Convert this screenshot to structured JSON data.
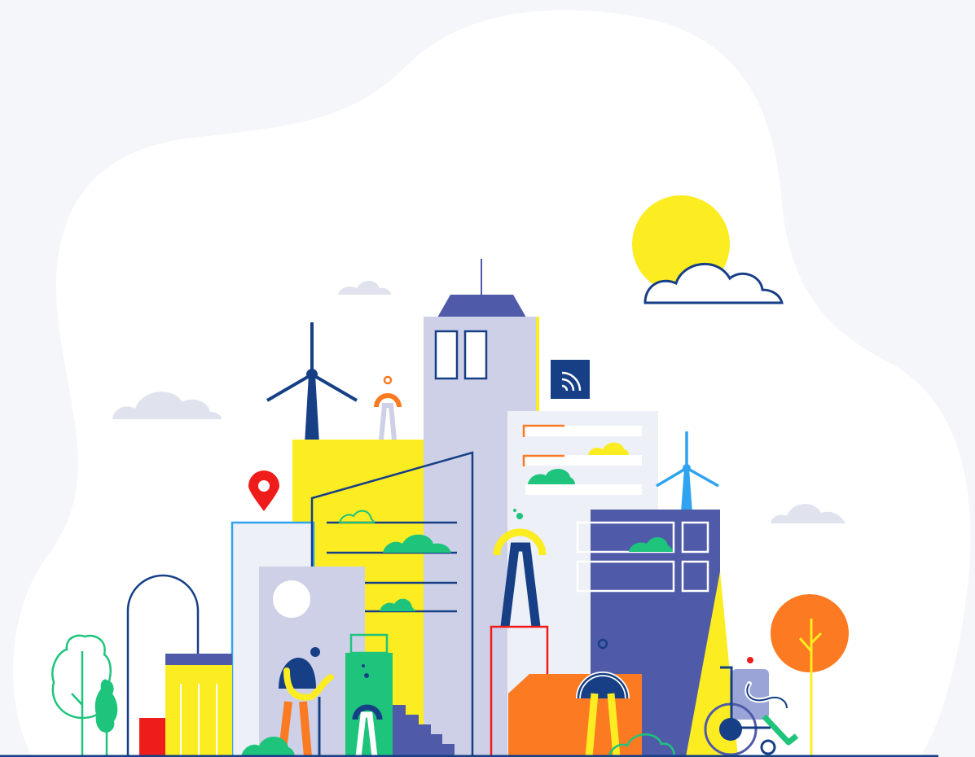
{
  "illustration": {
    "subject": "smart-city",
    "icons": [
      "sun-icon",
      "cloud-icon",
      "wind-turbine-icon",
      "location-pin-icon",
      "wifi-signal-icon",
      "tree-icon",
      "wheelchair-icon",
      "person-icon",
      "building-icon",
      "staircase-icon",
      "bush-icon"
    ]
  },
  "colors": {
    "page_bg": "#f5f6fa",
    "blob": "#ffffff",
    "navy": "#163f86",
    "indigo": "#4f5aa8",
    "lavender": "#cdd0e6",
    "pale": "#eef0f7",
    "yellow": "#fcec22",
    "orange": "#fc7a22",
    "green": "#1ec47c",
    "red": "#ef1c1c",
    "sky": "#2fa3ef",
    "soft_cloud": "#e0e2ee"
  }
}
